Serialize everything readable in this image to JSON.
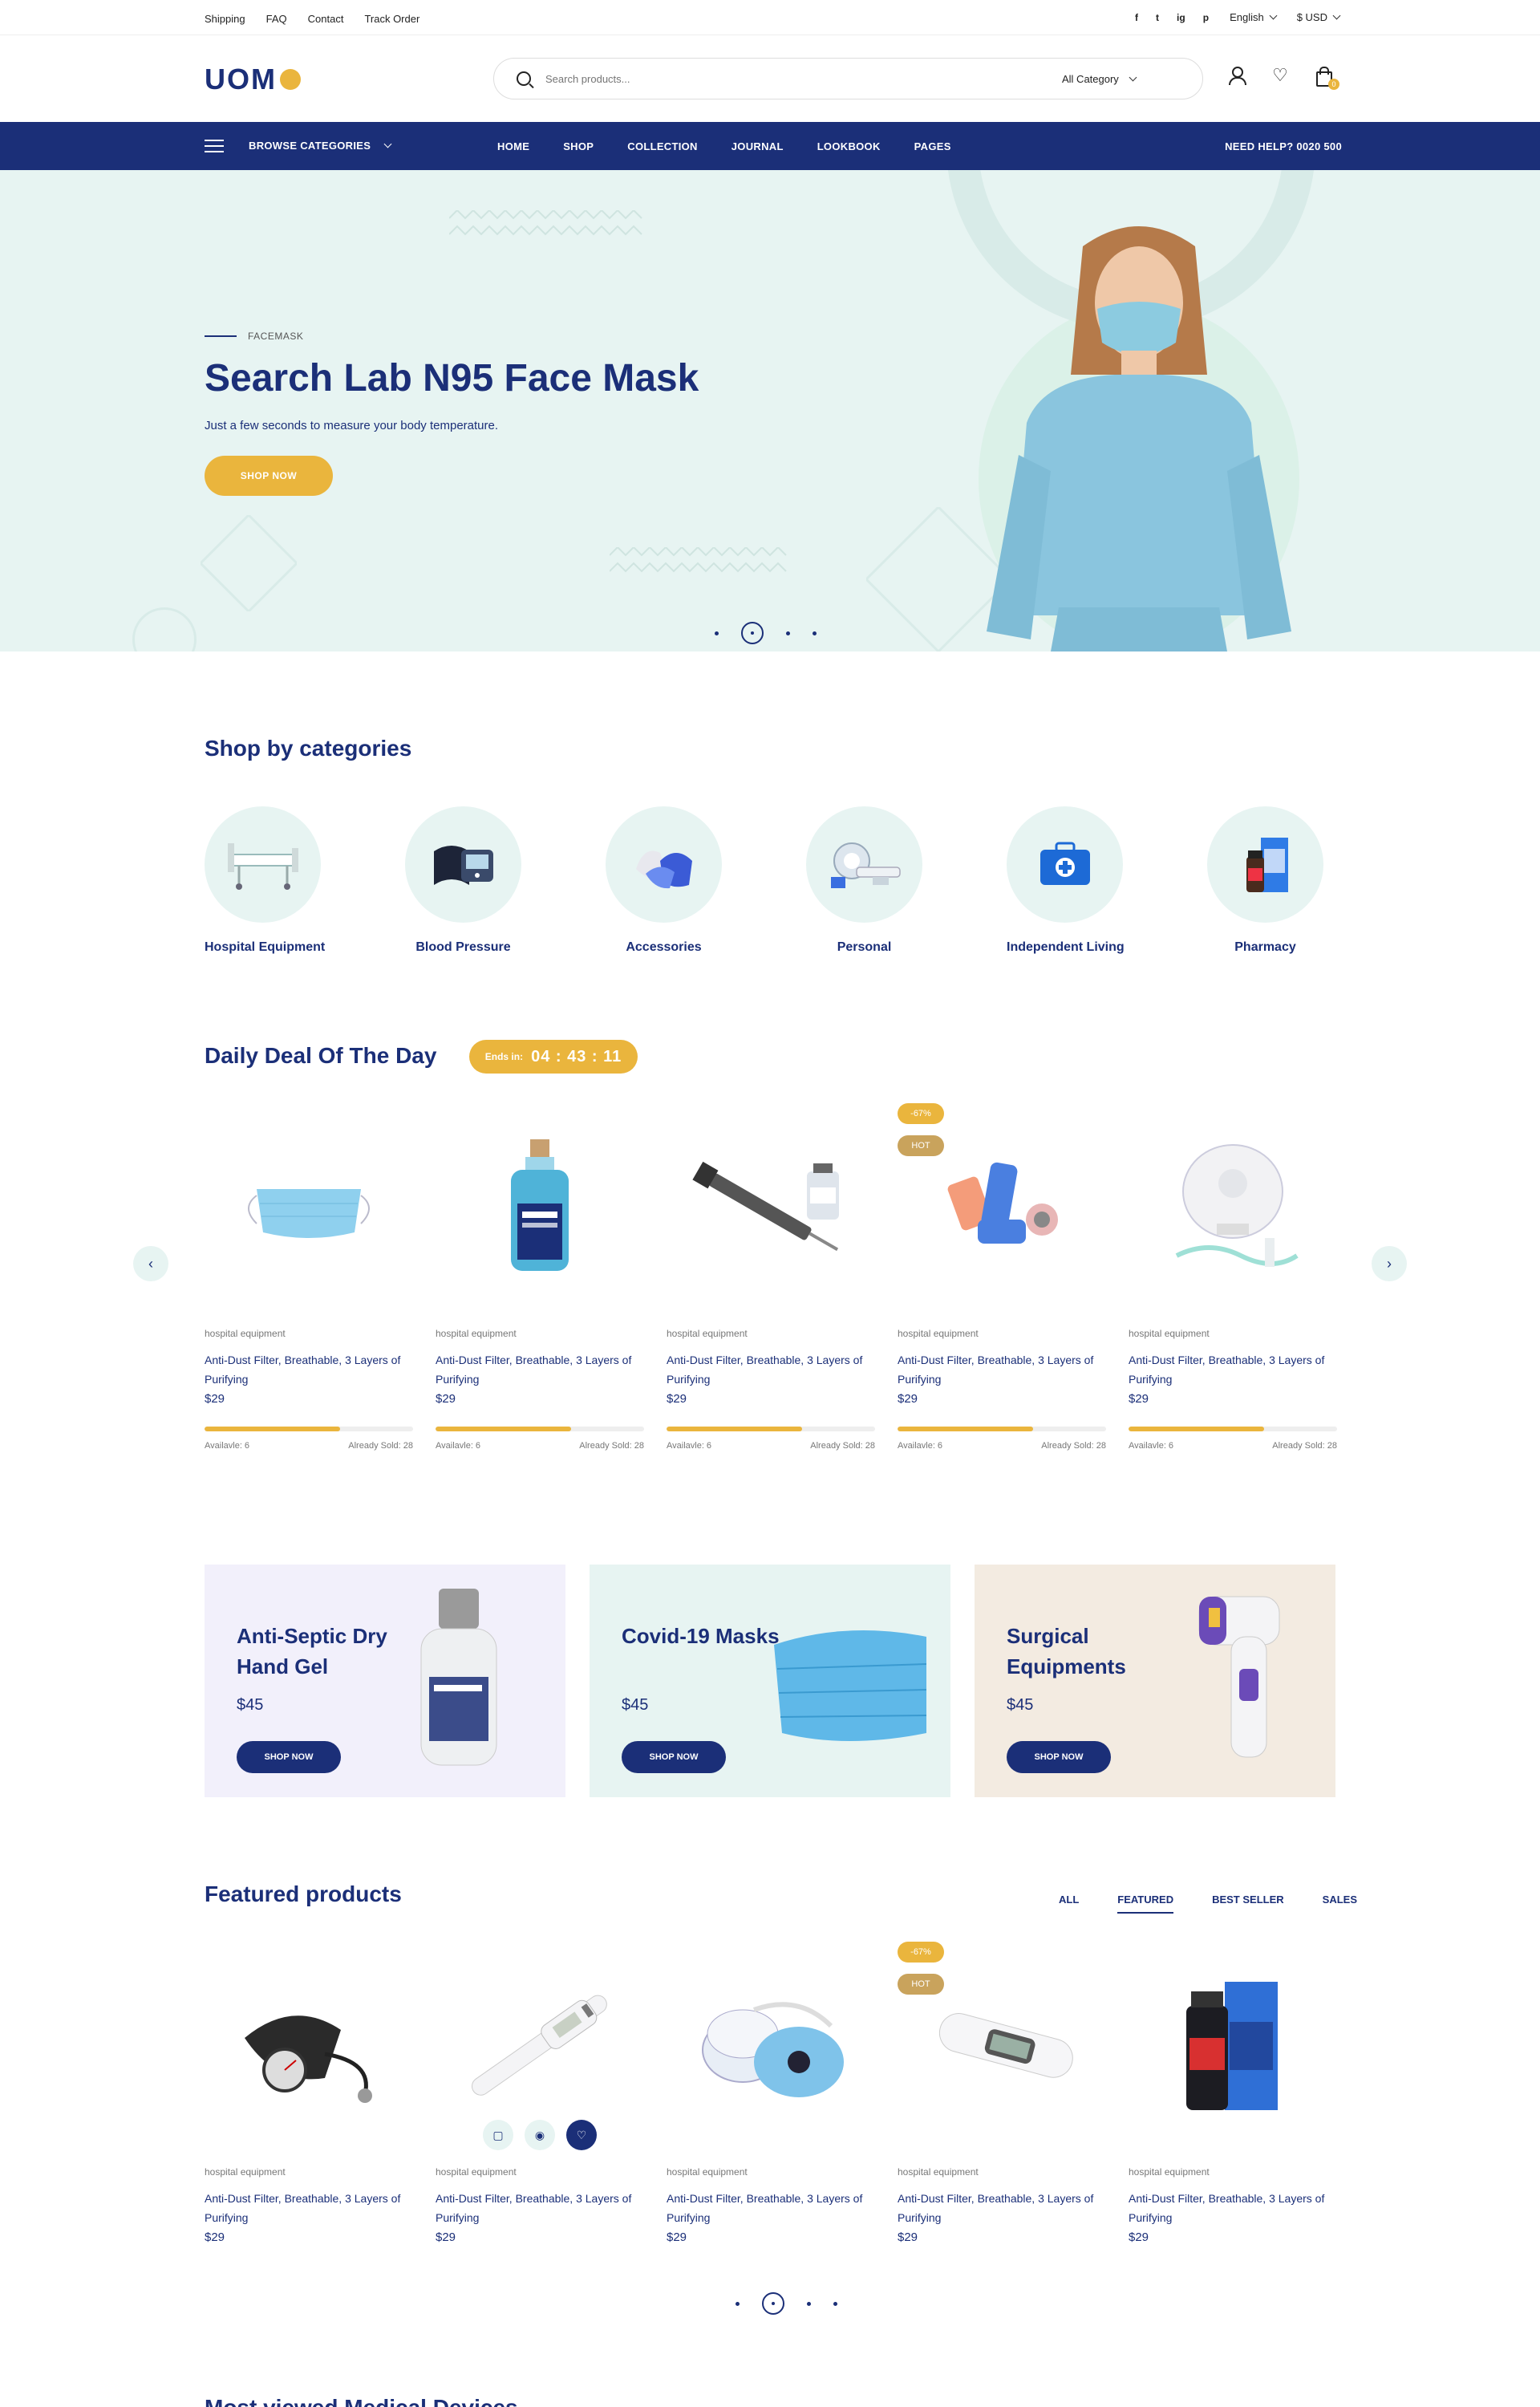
{
  "topbar": {
    "links": [
      "Shipping",
      "FAQ",
      "Contact",
      "Track Order"
    ],
    "social": [
      "f",
      "t",
      "ig",
      "p"
    ],
    "language": "English",
    "currency": "$ USD"
  },
  "header": {
    "logo": "UOM",
    "search_placeholder": "Search products...",
    "category": "All Category",
    "cart_count": "0"
  },
  "nav": {
    "browse": "BROWSE CATEGORIES",
    "items": [
      "HOME",
      "SHOP",
      "COLLECTION",
      "JOURNAL",
      "LOOKBOOK",
      "PAGES"
    ],
    "help": "NEED HELP? 0020 500"
  },
  "hero": {
    "eyebrow": "FACEMASK",
    "title": "Search Lab N95 Face Mask",
    "subtitle": "Just a few seconds to measure your body temperature.",
    "button": "SHOP NOW"
  },
  "categories": {
    "title": "Shop by categories",
    "items": [
      {
        "label": "Hospital Equipment"
      },
      {
        "label": "Blood Pressure"
      },
      {
        "label": "Accessories"
      },
      {
        "label": "Personal"
      },
      {
        "label": "Independent Living"
      },
      {
        "label": "Pharmacy"
      }
    ]
  },
  "deal": {
    "title": "Daily Deal Of The Day",
    "ends_label": "Ends in:",
    "timer": "04 : 43 : 11",
    "products": [
      {
        "category": "hospital equipment",
        "name": "Anti-Dust Filter, Breathable, 3 Layers of Purifying",
        "price": "$29",
        "available": "Availavle: 6",
        "sold": "Already Sold: 28",
        "sold_fraction": 0.65
      },
      {
        "category": "hospital equipment",
        "name": "Anti-Dust Filter, Breathable, 3 Layers of Purifying",
        "price": "$29",
        "available": "Availavle: 6",
        "sold": "Already Sold: 28",
        "sold_fraction": 0.65
      },
      {
        "category": "hospital equipment",
        "name": "Anti-Dust Filter, Breathable, 3 Layers of Purifying",
        "price": "$29",
        "available": "Availavle: 6",
        "sold": "Already Sold: 28",
        "sold_fraction": 0.65,
        "badges": []
      },
      {
        "category": "hospital equipment",
        "name": "Anti-Dust Filter, Breathable, 3 Layers of Purifying",
        "price": "$29",
        "available": "Availavle: 6",
        "sold": "Already Sold: 28",
        "sold_fraction": 0.65,
        "badge_discount": "-67%",
        "badge_hot": "HOT"
      },
      {
        "category": "hospital equipment",
        "name": "Anti-Dust Filter, Breathable, 3 Layers of Purifying",
        "price": "$29",
        "available": "Availavle: 6",
        "sold": "Already Sold: 28",
        "sold_fraction": 0.65
      }
    ]
  },
  "banners": [
    {
      "title": "Anti-Septic Dry Hand Gel",
      "price": "$45",
      "button": "SHOP NOW",
      "bg": "#f2f0fb"
    },
    {
      "title": "Covid-19 Masks",
      "price": "$45",
      "button": "SHOP NOW",
      "bg": "#e7f4f2"
    },
    {
      "title": "Surgical Equipments",
      "price": "$45",
      "button": "SHOP NOW",
      "bg": "#f3ebe1"
    }
  ],
  "featured": {
    "title": "Featured products",
    "tabs": [
      "ALL",
      "FEATURED",
      "BEST SELLER",
      "SALES"
    ],
    "active_tab": "FEATURED",
    "products": [
      {
        "category": "hospital equipment",
        "name": "Anti-Dust Filter, Breathable, 3 Layers of Purifying",
        "price": "$29"
      },
      {
        "category": "hospital equipment",
        "name": "Anti-Dust Filter, Breathable, 3 Layers of Purifying",
        "price": "$29"
      },
      {
        "category": "hospital equipment",
        "name": "Anti-Dust Filter, Breathable, 3 Layers of Purifying",
        "price": "$29"
      },
      {
        "category": "hospital equipment",
        "name": "Anti-Dust Filter, Breathable, 3 Layers of Purifying",
        "price": "$29",
        "badge_discount": "-67%",
        "badge_hot": "HOT"
      },
      {
        "category": "hospital equipment",
        "name": "Anti-Dust Filter, Breathable, 3 Layers of Purifying",
        "price": "$29"
      }
    ]
  },
  "next_section": {
    "title": "Most viewed Medical Devices"
  },
  "colors": {
    "primary": "#1b2f78",
    "accent": "#eab53d",
    "mint": "#e7f4f2",
    "hot_badge": "#c9a35c"
  }
}
